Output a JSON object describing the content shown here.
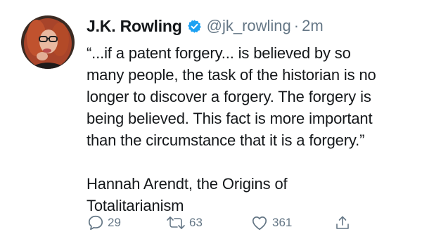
{
  "tweet": {
    "author_name": "J.K. Rowling",
    "handle": "@jk_rowling",
    "separator": "·",
    "time": "2m",
    "text": "“...if a patent forgery... is believed by so\nmany people, the task of the historian is no\nlonger to discover a forgery. The forgery is\nbeing believed. This fact is more important\nthan the circumstance that it is a forgery.”\n\nHannah Arendt, the Origins of\nTotalitarianism",
    "verified_icon": "verified-badge-icon",
    "avatar_icon": "profile-avatar"
  },
  "actions": {
    "reply_count": "29",
    "retweet_count": "63",
    "like_count": "361",
    "reply_icon": "reply-icon",
    "retweet_icon": "retweet-icon",
    "like_icon": "heart-icon",
    "share_icon": "share-icon"
  },
  "colors": {
    "verified": "#1da1f2",
    "secondary_text": "#657786",
    "primary_text": "#14171a"
  }
}
